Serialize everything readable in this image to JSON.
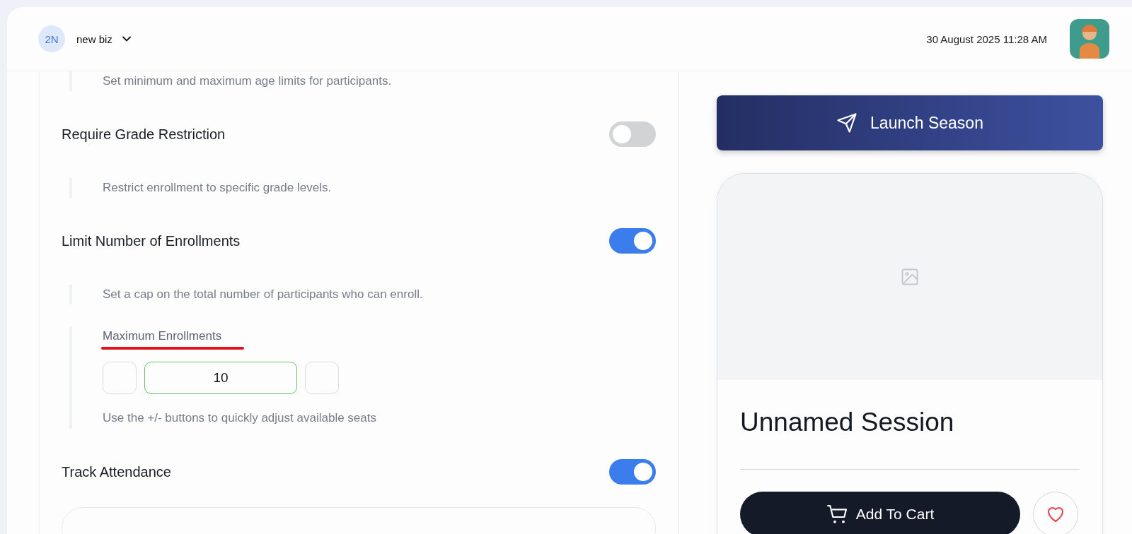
{
  "header": {
    "business": {
      "initials": "2N",
      "name": "new biz"
    },
    "datetime": "30 August 2025 11:28 AM"
  },
  "settings": [
    {
      "kind": "description",
      "text": "Set minimum and maximum age limits for participants."
    },
    {
      "kind": "toggle",
      "label": "Require Grade Restriction",
      "on": false
    },
    {
      "kind": "description",
      "text": "Restrict enrollment to specific grade levels."
    },
    {
      "kind": "toggle",
      "label": "Limit Number of Enrollments",
      "on": true
    },
    {
      "kind": "description",
      "text": "Set a cap on the total number of participants who can enroll."
    },
    {
      "kind": "number_field",
      "label": "Maximum Enrollments",
      "underlined": true,
      "value": "10",
      "hint": "Use the +/- buttons to quickly adjust available seats"
    },
    {
      "kind": "toggle",
      "label": "Track Attendance",
      "on": true
    }
  ],
  "launch_button": "Launch Season",
  "preview": {
    "title": "Unnamed Session",
    "cart_button": "Add To Cart"
  }
}
